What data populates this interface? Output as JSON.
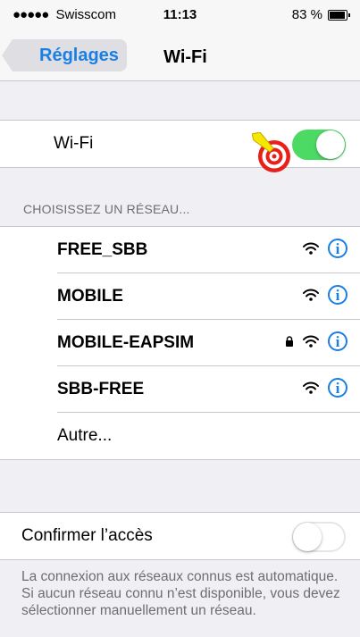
{
  "statusbar": {
    "carrier_dots": "●●●●●",
    "carrier": "Swisscom",
    "time": "11:13",
    "battery": "83 %"
  },
  "navbar": {
    "back_label": "Réglages",
    "title": "Wi-Fi"
  },
  "wifi": {
    "label": "Wi-Fi",
    "enabled": true
  },
  "networks_header": "CHOISISSEZ UN RÉSEAU...",
  "networks": [
    {
      "name": "FREE_SBB",
      "locked": false
    },
    {
      "name": "MOBILE",
      "locked": false
    },
    {
      "name": "MOBILE-EAPSIM",
      "locked": true
    },
    {
      "name": "SBB-FREE",
      "locked": false
    }
  ],
  "other_label": "Autre...",
  "confirm": {
    "label": "Confirmer l’accès",
    "enabled": false
  },
  "footer": "La connexion aux réseaux connus est automatique. Si aucun réseau connu n’est disponible, vous devez sélectionner manuellement un réseau.",
  "colors": {
    "accent": "#1a7fe5",
    "toggle_on": "#4cd964",
    "background": "#efeff4"
  }
}
